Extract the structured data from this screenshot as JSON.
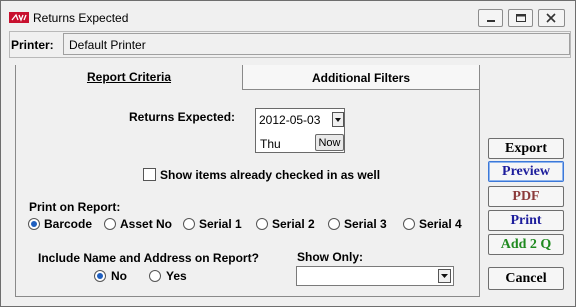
{
  "window": {
    "title": "Returns Expected"
  },
  "printer": {
    "label": "Printer:",
    "value": "Default Printer"
  },
  "tabs": [
    {
      "label": "Report Criteria",
      "active": true
    },
    {
      "label": "Additional Filters",
      "active": false
    }
  ],
  "criteria": {
    "returns_expected_label": "Returns Expected:",
    "date": "2012-05-03",
    "day": "Thu",
    "now_label": "Now",
    "checked_in_label": "Show items already checked in as well",
    "checked_in": false
  },
  "print_on": {
    "label": "Print on Report:",
    "options": [
      "Barcode",
      "Asset No",
      "Serial 1",
      "Serial 2",
      "Serial 3",
      "Serial 4"
    ],
    "selected": "Barcode"
  },
  "include_name": {
    "label": "Include Name and Address on Report?",
    "options": [
      "No",
      "Yes"
    ],
    "selected": "No"
  },
  "show_only": {
    "label": "Show Only:",
    "value": ""
  },
  "buttons": {
    "export": "Export",
    "preview": "Preview",
    "pdf": "PDF",
    "print": "Print",
    "add2q": "Add 2 Q",
    "cancel": "Cancel"
  },
  "colors": {
    "preview": "#1d1d9c",
    "pdf": "#8b3a3a",
    "print": "#1d1d9c",
    "add2q": "#1f8a1f",
    "radio_selected": "#1f5fbf"
  }
}
